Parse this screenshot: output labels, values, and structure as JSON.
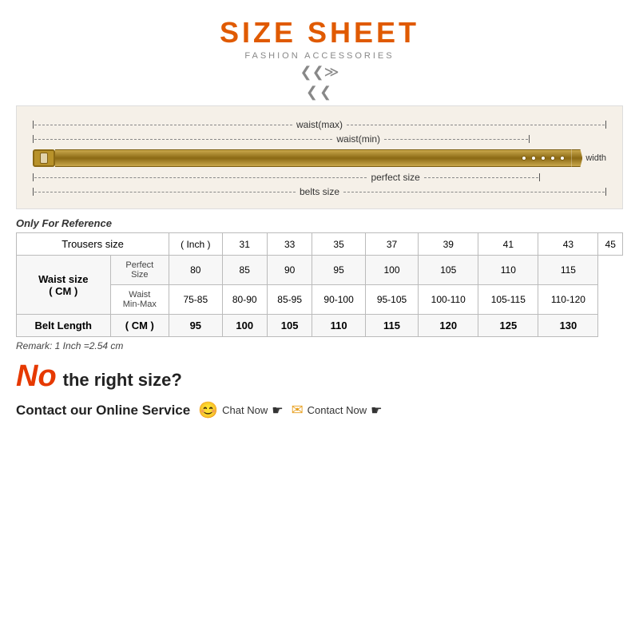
{
  "title": "SIZE SHEET",
  "subtitle": "FASHION ACCESSORIES",
  "diagram": {
    "rows": [
      {
        "label": "waist(max)",
        "short": false
      },
      {
        "label": "waist(min)",
        "short": true
      },
      {
        "label": "perfect size",
        "medium": true
      },
      {
        "label": "belts size",
        "short": false
      }
    ],
    "belt_holes": 5,
    "width_label": "width"
  },
  "reference_note": "Only For Reference",
  "table": {
    "headers": [
      "Trousers size",
      "( Inch )",
      "31",
      "33",
      "35",
      "37",
      "39",
      "41",
      "43",
      "45"
    ],
    "waist_label": "Waist size\n( CM )",
    "rows": [
      {
        "group": "Waist size\n( CM )",
        "subrows": [
          {
            "label": "Perfect\nSize",
            "values": [
              "80",
              "85",
              "90",
              "95",
              "100",
              "105",
              "110",
              "115"
            ]
          },
          {
            "label": "Waist\nMin-Max",
            "values": [
              "75-85",
              "80-90",
              "85-95",
              "90-100",
              "95-105",
              "100-110",
              "105-115",
              "110-120"
            ]
          }
        ]
      },
      {
        "bold": true,
        "label": "Belt Length",
        "unit": "( CM )",
        "values": [
          "95",
          "100",
          "105",
          "110",
          "115",
          "120",
          "125",
          "130"
        ]
      }
    ]
  },
  "remark": "Remark: 1 Inch =2.54 cm",
  "no_size": {
    "no_text": "No",
    "rest_text": "the right size?"
  },
  "contact": {
    "label": "Contact our Online Service",
    "chat_label": "Chat Now",
    "contact_label": "Contact Now"
  }
}
